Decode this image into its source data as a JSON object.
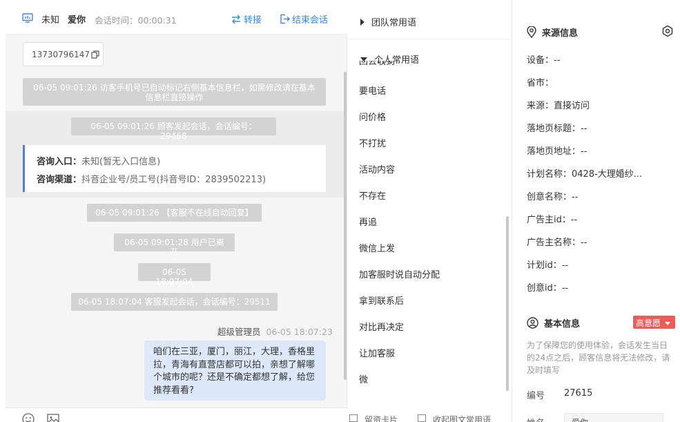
{
  "chat": {
    "header": {
      "status": "未知",
      "nickname": "爱你",
      "session_time_label": "会话时间：",
      "session_time": "00:00:31",
      "transfer_label": "转接",
      "end_label": "结束会话"
    },
    "phone": "13730796147",
    "messages": [
      "06-05 09:01:26 访客手机号已自动标记右侧基本信息栏，如需修改请在基本信息栏直接操作",
      "06-05 09:01:26 顾客发起会话，会话编号：29468",
      "06-05 09:01:26 【客服不在线自动回复】",
      "06-05 09:01:28 用户已离开",
      "06-05 18:07:04",
      "06-05 18:07:04 客服发起会话，会话编号：29511"
    ],
    "info_card": {
      "entry_label": "咨询入口：",
      "entry_value": "未知(暂无入口信息)",
      "channel_label": "咨询渠道：",
      "channel_value": "抖音企业号/员工号(抖音号ID：2839502213)"
    },
    "agent_name": "超级管理员",
    "agent_time": "06-05 18:07:23",
    "agent_message": "咱们在三亚，厦门，丽江，大理，香格里拉，青海有直营店都可以拍，亲想了解哪个城市的呢？还是不确定都想了解，给您推荐看看?"
  },
  "phrases": {
    "team_group": "团队常用语",
    "personal_group": "个人常用语",
    "cut_item": "回去收到",
    "items": [
      "要电话",
      "问价格",
      "不打扰",
      "活动内容",
      "不存在",
      "再追",
      "微信上发",
      "加客服时说自动分配",
      "拿到联系后",
      "对比再决定",
      "让加客服",
      "微"
    ],
    "footer_left": "留资卡片",
    "footer_right": "收起图文常用语"
  },
  "source_info": {
    "title": "来源信息",
    "device": "设备：--",
    "province": "省市：",
    "source": "来源：直接访问",
    "landing_title": "落地页标题：--",
    "landing_url": "落地页地址：--",
    "plan_name": "计划名称：0428-大理婚纱...",
    "creative_name": "创意名称：--",
    "advertiser_id": "广告主id：--",
    "advertiser_name": "广告主名称：--",
    "plan_id": "计划id：--",
    "creative_id": "创意id：--"
  },
  "basic_info": {
    "title": "基本信息",
    "intent_badge": "高意愿",
    "note": "为了保障您的使用体验，会话发生当日的24点之后，顾客信息将无法修改，请及时填写",
    "id_label": "编号",
    "id_value": "27615",
    "name_label": "姓名",
    "name_value": "爱你"
  },
  "colors": {
    "accent": "#3a86f0",
    "bubble": "#dde8fb",
    "system_msg": "#d3d3d3",
    "badge": "#f25a5a"
  }
}
